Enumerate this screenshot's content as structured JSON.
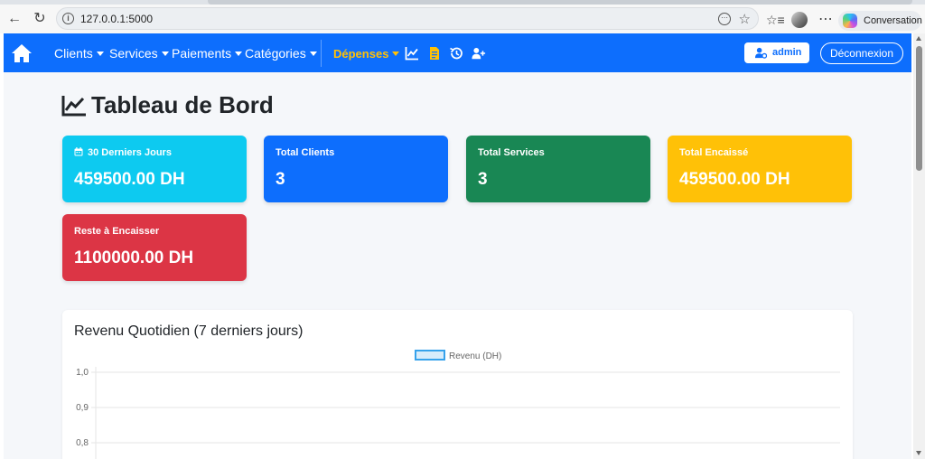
{
  "browser": {
    "url": "127.0.0.1:5000",
    "conversation_label": "Conversation"
  },
  "navbar": {
    "menus": [
      {
        "label": "Clients"
      },
      {
        "label": "Services"
      },
      {
        "label": "Paiements"
      },
      {
        "label": "Catégories"
      }
    ],
    "depenses_label": "Dépenses",
    "admin_label": "admin",
    "logout_label": "Déconnexion",
    "colors": {
      "bar": "#0d6efd",
      "depenses": "#ffc107"
    }
  },
  "page": {
    "title": "Tableau de Bord"
  },
  "cards": [
    {
      "title": "30 Derniers Jours",
      "value": "459500.00 DH",
      "color": "#0dcaf0",
      "icon": "calendar-icon"
    },
    {
      "title": "Total Clients",
      "value": "3",
      "color": "#0d6efd"
    },
    {
      "title": "Total Services",
      "value": "3",
      "color": "#198754"
    },
    {
      "title": "Total Encaissé",
      "value": "459500.00 DH",
      "color": "#ffc107"
    },
    {
      "title": "Reste à Encaisser",
      "value": "1100000.00 DH",
      "color": "#dc3545"
    }
  ],
  "chart_panel": {
    "title": "Revenu Quotidien (7 derniers jours)"
  },
  "chart_data": {
    "type": "line",
    "title": "Revenu Quotidien (7 derniers jours)",
    "series": [
      {
        "name": "Revenu (DH)",
        "values": []
      }
    ],
    "y_ticks": [
      "1,0",
      "0,9",
      "0,8"
    ],
    "legend_position": "top-center",
    "grid": true
  }
}
